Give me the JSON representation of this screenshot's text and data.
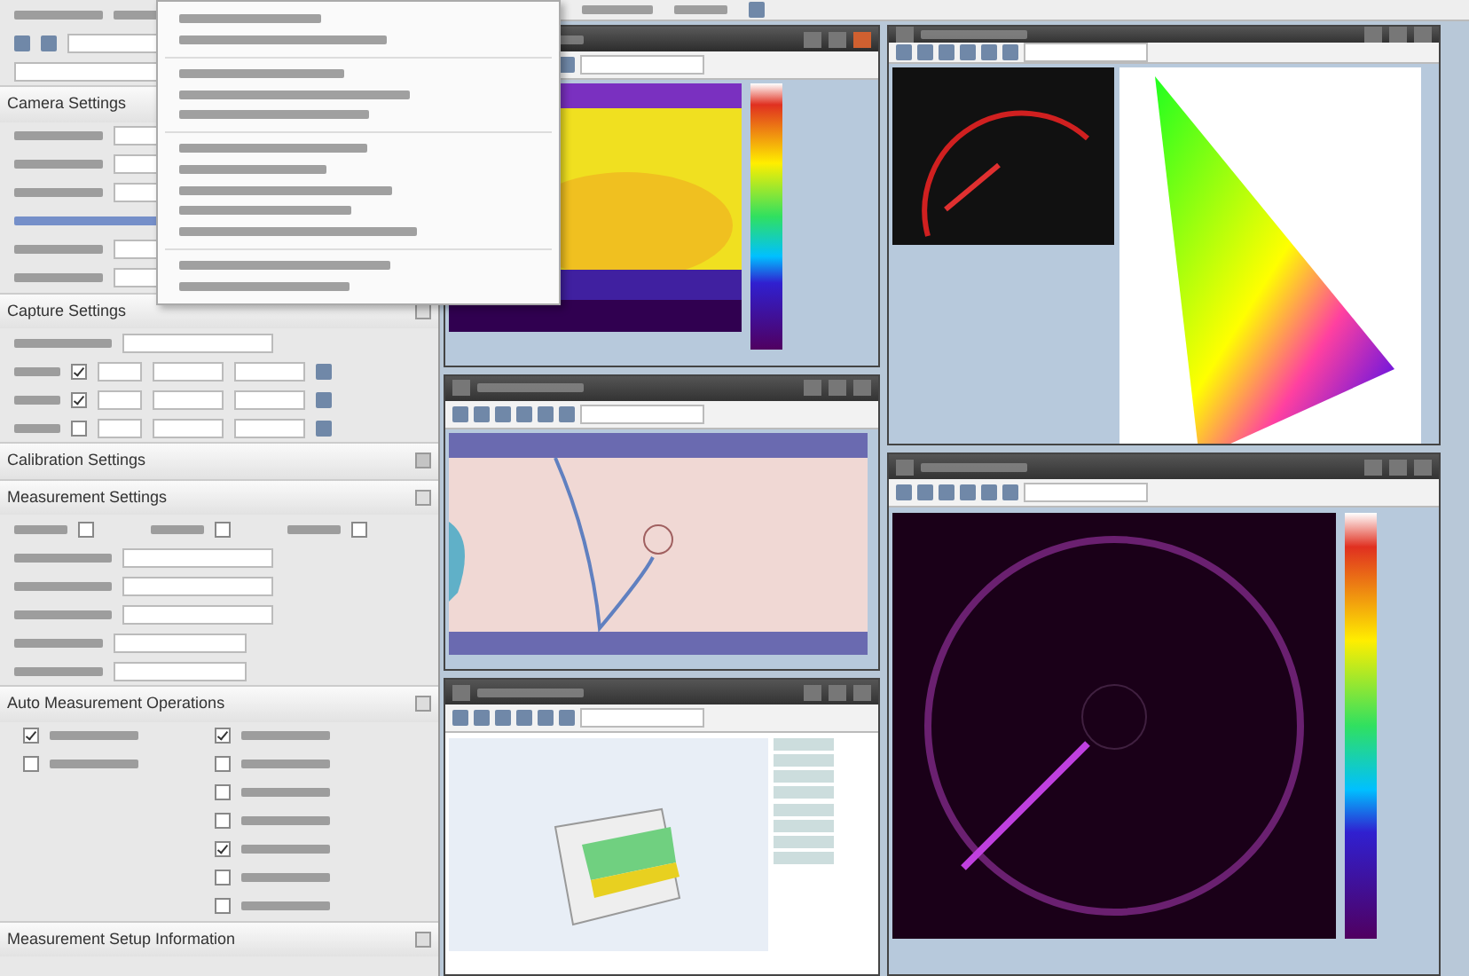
{
  "left_panel": {
    "sections": [
      {
        "title": "Camera Settings",
        "rows": [
          {
            "kind": "field"
          },
          {
            "kind": "field"
          },
          {
            "kind": "field"
          },
          {
            "kind": "link"
          },
          {
            "kind": "field"
          },
          {
            "kind": "field"
          }
        ]
      },
      {
        "title": "Capture Settings",
        "expanded": true,
        "rows": [
          {
            "kind": "combo"
          },
          {
            "kind": "filter",
            "checked": true
          },
          {
            "kind": "filter",
            "checked": true
          },
          {
            "kind": "filter",
            "checked": false
          }
        ]
      },
      {
        "title": "Calibration Settings",
        "expanded": false
      },
      {
        "title": "Measurement Settings",
        "expanded": true,
        "checks": [
          {
            "checked": false
          },
          {
            "checked": false
          },
          {
            "checked": false
          }
        ],
        "rows": [
          {
            "kind": "combo"
          },
          {
            "kind": "combo"
          },
          {
            "kind": "combo"
          },
          {
            "kind": "field"
          },
          {
            "kind": "field"
          }
        ]
      },
      {
        "title": "Auto Measurement Operations",
        "expanded": true,
        "left": [
          {
            "checked": true
          },
          {
            "checked": false
          }
        ],
        "right": [
          {
            "checked": true
          },
          {
            "checked": false
          },
          {
            "checked": false
          },
          {
            "checked": false
          },
          {
            "checked": true
          },
          {
            "checked": false
          },
          {
            "checked": false
          }
        ]
      },
      {
        "title": "Measurement Setup Information",
        "expanded": true
      }
    ]
  },
  "windows": [
    {
      "kind": "thermal",
      "active": true
    },
    {
      "kind": "map",
      "active": false
    },
    {
      "kind": "surface3d",
      "active": false
    },
    {
      "kind": "cie",
      "active": false
    },
    {
      "kind": "speedometer",
      "active": false
    }
  ]
}
